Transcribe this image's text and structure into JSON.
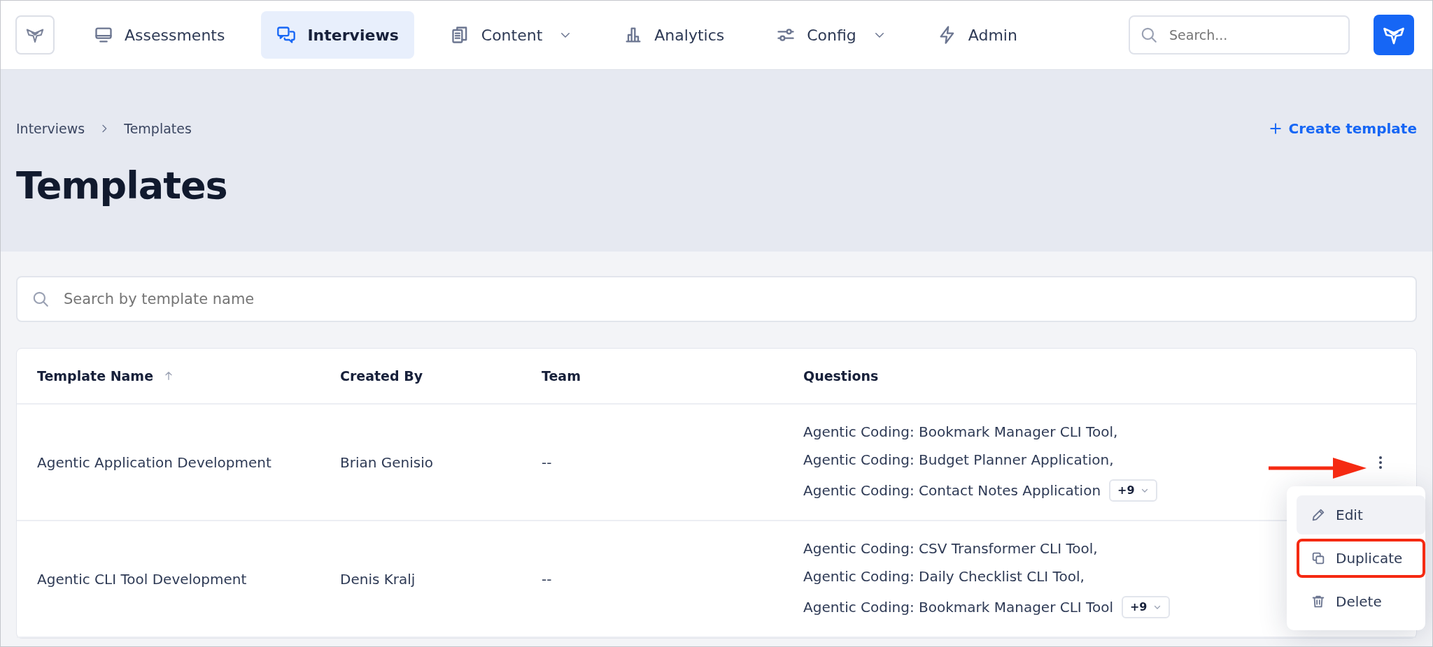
{
  "nav": {
    "items": [
      {
        "label": "Assessments",
        "selected": false,
        "dropdown": false
      },
      {
        "label": "Interviews",
        "selected": true,
        "dropdown": false
      },
      {
        "label": "Content",
        "selected": false,
        "dropdown": true
      },
      {
        "label": "Analytics",
        "selected": false,
        "dropdown": false
      },
      {
        "label": "Config",
        "selected": false,
        "dropdown": true
      },
      {
        "label": "Admin",
        "selected": false,
        "dropdown": false
      }
    ],
    "search": {
      "placeholder": "Search..."
    }
  },
  "breadcrumb": [
    "Interviews",
    "Templates"
  ],
  "create_button": "Create template",
  "title": "Templates",
  "search": {
    "placeholder": "Search by template name"
  },
  "table": {
    "columns": [
      {
        "label": "Template Name",
        "sorted": true
      },
      {
        "label": "Created By",
        "sorted": false
      },
      {
        "label": "Team",
        "sorted": false
      },
      {
        "label": "Questions",
        "sorted": false
      }
    ],
    "rows": [
      {
        "name": "Agentic Application Development",
        "created_by": "Brian Genisio",
        "team": "--",
        "questions": [
          "Agentic Coding: Bookmark Manager CLI Tool,",
          "Agentic Coding: Budget Planner Application,",
          "Agentic Coding: Contact Notes Application"
        ],
        "more": "+9",
        "actions_button": true
      },
      {
        "name": "Agentic CLI Tool Development",
        "created_by": "Denis Kralj",
        "team": "--",
        "questions": [
          "Agentic Coding: CSV Transformer CLI Tool,",
          "Agentic Coding: Daily Checklist CLI Tool,",
          "Agentic Coding: Bookmark Manager CLI Tool"
        ],
        "more": "+9",
        "actions_button": false
      }
    ]
  },
  "row_menu": {
    "items": [
      {
        "label": "Edit",
        "kind": "edit",
        "selected": true,
        "highlighted": false
      },
      {
        "label": "Duplicate",
        "kind": "duplicate",
        "selected": false,
        "highlighted": true
      },
      {
        "label": "Delete",
        "kind": "delete",
        "selected": false,
        "highlighted": false
      }
    ]
  }
}
